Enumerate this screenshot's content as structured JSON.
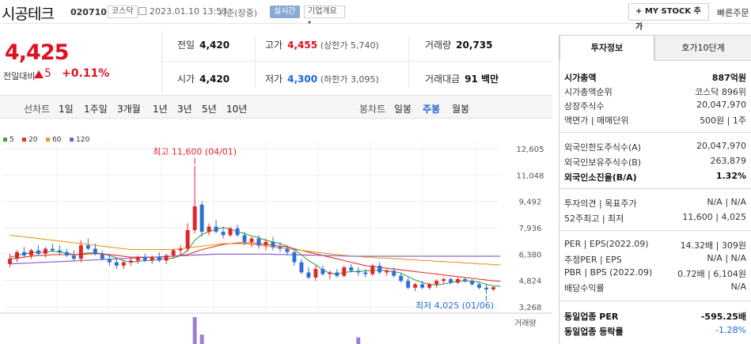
{
  "header": {
    "stock_name": "시공테크",
    "stock_code": "020710",
    "market_badge": "코스닥",
    "datetime": "2023.01.10 13:53",
    "datetime_basis": "기준(장중)",
    "realtime_badge": "실시간",
    "company_overview": "기업개요",
    "mystock_button": "+ MY STOCK 추가",
    "quick_order": "빠른주문"
  },
  "price": {
    "current": "4,425",
    "compare_label": "전일대비",
    "change": "5",
    "change_pct": "+0.11%"
  },
  "quote": {
    "prev_label": "전일",
    "prev": "4,420",
    "high_label": "고가",
    "high": "4,455",
    "upper_limit": "(상한가 5,740)",
    "volume_label": "거래량",
    "volume": "20,735",
    "open_label": "시가",
    "open": "4,420",
    "low_label": "저가",
    "low": "4,300",
    "lower_limit": "(하한가 3,095)",
    "amount_label": "거래대금",
    "amount": "91 백만"
  },
  "periods": {
    "line_label": "선차트",
    "items": [
      "1일",
      "1주일",
      "3개월",
      "1년",
      "3년",
      "5년",
      "10년"
    ],
    "candle_label": "봉차트",
    "candle_items": [
      "일봉",
      "주봉",
      "월봉"
    ],
    "active_candle": "주봉"
  },
  "tabs": [
    "투자정보",
    "호가10단계"
  ],
  "invest": {
    "market_cap_label": "시가총액",
    "market_cap": "887억원",
    "cap_rank_label": "시가총액순위",
    "cap_rank": "코스닥 896위",
    "shares_label": "상장주식수",
    "shares": "20,047,970",
    "par_label": "액면가 | 매매단위",
    "par": "500원 | 1주",
    "foreign_limit_label": "외국인한도주식수(A)",
    "foreign_limit": "20,047,970",
    "foreign_hold_label": "외국인보유주식수(B)",
    "foreign_hold": "263,879",
    "foreign_ratio_label": "외국인소진율(B/A)",
    "foreign_ratio": "1.32%",
    "opinion_label": "투자의견 | 목표주가",
    "opinion": "N/A | N/A",
    "w52_label": "52주최고 | 최저",
    "w52": "11,600 | 4,025",
    "per_label": "PER | EPS(2022.09)",
    "per": "14.32배 | 309원",
    "est_per_label": "추정PER | EPS",
    "est_per": "N/A | N/A",
    "pbr_label": "PBR | BPS (2022.09)",
    "pbr": "0.72배 | 6,104원",
    "div_label": "배당수익률",
    "div": "N/A",
    "ind_per_label": "동일업종 PER",
    "ind_per": "-595.25배",
    "ind_rate_label": "동일업종 등락률",
    "ind_rate": "-1.28%"
  },
  "chart_data": {
    "type": "candlestick",
    "ma_legend": [
      "5",
      "20",
      "60",
      "120"
    ],
    "ma_colors": [
      "#3aa33a",
      "#e53030",
      "#e89a1c",
      "#8a57c8"
    ],
    "y_ticks": [
      "12,605",
      "11,048",
      "9,492",
      "7,936",
      "6,380",
      "4,824",
      "3,268"
    ],
    "y_values": [
      12605,
      11048,
      9492,
      7936,
      6380,
      4824,
      3268
    ],
    "ylim": [
      3268,
      12605
    ],
    "high_annotation": "최고 11,600 (04/01)",
    "low_annotation": "최저 4,025 (01/06)",
    "volume_label": "거래량",
    "candles": [
      {
        "o": 5800,
        "h": 6400,
        "l": 5600,
        "c": 6100
      },
      {
        "o": 6100,
        "h": 6600,
        "l": 5900,
        "c": 6500
      },
      {
        "o": 6500,
        "h": 6800,
        "l": 6200,
        "c": 6300
      },
      {
        "o": 6300,
        "h": 6700,
        "l": 6100,
        "c": 6600
      },
      {
        "o": 6600,
        "h": 6900,
        "l": 6300,
        "c": 6400
      },
      {
        "o": 6400,
        "h": 6800,
        "l": 6200,
        "c": 6700
      },
      {
        "o": 6700,
        "h": 7000,
        "l": 6500,
        "c": 6600
      },
      {
        "o": 6600,
        "h": 6900,
        "l": 6300,
        "c": 6500
      },
      {
        "o": 6500,
        "h": 6700,
        "l": 6200,
        "c": 6300
      },
      {
        "o": 6300,
        "h": 6600,
        "l": 6000,
        "c": 6100
      },
      {
        "o": 6100,
        "h": 7200,
        "l": 5900,
        "c": 6900
      },
      {
        "o": 6900,
        "h": 7300,
        "l": 6600,
        "c": 6700
      },
      {
        "o": 6700,
        "h": 7000,
        "l": 6300,
        "c": 6400
      },
      {
        "o": 6400,
        "h": 6600,
        "l": 6000,
        "c": 6100
      },
      {
        "o": 6100,
        "h": 6400,
        "l": 5700,
        "c": 5900
      },
      {
        "o": 5900,
        "h": 6200,
        "l": 5500,
        "c": 5700
      },
      {
        "o": 5700,
        "h": 6000,
        "l": 5500,
        "c": 5900
      },
      {
        "o": 5900,
        "h": 6200,
        "l": 5700,
        "c": 6000
      },
      {
        "o": 6000,
        "h": 6300,
        "l": 5800,
        "c": 6200
      },
      {
        "o": 6200,
        "h": 6400,
        "l": 5900,
        "c": 6000
      },
      {
        "o": 6000,
        "h": 6300,
        "l": 5800,
        "c": 6200
      },
      {
        "o": 6200,
        "h": 6500,
        "l": 5900,
        "c": 6000
      },
      {
        "o": 6000,
        "h": 6400,
        "l": 5800,
        "c": 6300
      },
      {
        "o": 6300,
        "h": 6700,
        "l": 6100,
        "c": 6600
      },
      {
        "o": 6600,
        "h": 6900,
        "l": 6300,
        "c": 6700
      },
      {
        "o": 6700,
        "h": 8200,
        "l": 6500,
        "c": 7800
      },
      {
        "o": 7800,
        "h": 11600,
        "l": 7600,
        "c": 9200
      },
      {
        "o": 9300,
        "h": 9500,
        "l": 7400,
        "c": 7700
      },
      {
        "o": 7700,
        "h": 8200,
        "l": 7500,
        "c": 8000
      },
      {
        "o": 8000,
        "h": 8400,
        "l": 7600,
        "c": 7700
      },
      {
        "o": 7700,
        "h": 8000,
        "l": 7300,
        "c": 7500
      },
      {
        "o": 7500,
        "h": 8000,
        "l": 7400,
        "c": 7900
      },
      {
        "o": 7900,
        "h": 8100,
        "l": 7400,
        "c": 7500
      },
      {
        "o": 7500,
        "h": 7700,
        "l": 6900,
        "c": 7100
      },
      {
        "o": 7100,
        "h": 7400,
        "l": 6800,
        "c": 7300
      },
      {
        "o": 7300,
        "h": 7500,
        "l": 6700,
        "c": 6900
      },
      {
        "o": 6900,
        "h": 7300,
        "l": 6600,
        "c": 7100
      },
      {
        "o": 7100,
        "h": 7400,
        "l": 6600,
        "c": 6800
      },
      {
        "o": 6800,
        "h": 7100,
        "l": 6500,
        "c": 6700
      },
      {
        "o": 6700,
        "h": 6900,
        "l": 6300,
        "c": 6500
      },
      {
        "o": 6500,
        "h": 6700,
        "l": 5700,
        "c": 5900
      },
      {
        "o": 5900,
        "h": 6100,
        "l": 5200,
        "c": 5300
      },
      {
        "o": 5300,
        "h": 5600,
        "l": 4900,
        "c": 5000
      },
      {
        "o": 5000,
        "h": 5700,
        "l": 4800,
        "c": 5500
      },
      {
        "o": 5500,
        "h": 5700,
        "l": 5100,
        "c": 5200
      },
      {
        "o": 5200,
        "h": 5400,
        "l": 4900,
        "c": 5300
      },
      {
        "o": 5300,
        "h": 5500,
        "l": 5000,
        "c": 5100
      },
      {
        "o": 5100,
        "h": 5700,
        "l": 5000,
        "c": 5600
      },
      {
        "o": 5600,
        "h": 5800,
        "l": 5300,
        "c": 5400
      },
      {
        "o": 5400,
        "h": 5600,
        "l": 5100,
        "c": 5300
      },
      {
        "o": 5300,
        "h": 5500,
        "l": 5000,
        "c": 5200
      },
      {
        "o": 5200,
        "h": 5800,
        "l": 5100,
        "c": 5700
      },
      {
        "o": 5700,
        "h": 5900,
        "l": 5200,
        "c": 5300
      },
      {
        "o": 5300,
        "h": 5500,
        "l": 5100,
        "c": 5400
      },
      {
        "o": 5400,
        "h": 5600,
        "l": 5000,
        "c": 5100
      },
      {
        "o": 5100,
        "h": 5300,
        "l": 4700,
        "c": 4800
      },
      {
        "o": 4800,
        "h": 5000,
        "l": 4300,
        "c": 4400
      },
      {
        "o": 4400,
        "h": 4700,
        "l": 4200,
        "c": 4600
      },
      {
        "o": 4600,
        "h": 4800,
        "l": 4300,
        "c": 4400
      },
      {
        "o": 4400,
        "h": 4700,
        "l": 4300,
        "c": 4600
      },
      {
        "o": 4600,
        "h": 4900,
        "l": 4400,
        "c": 4800
      },
      {
        "o": 4800,
        "h": 5000,
        "l": 4600,
        "c": 4900
      },
      {
        "o": 4900,
        "h": 5000,
        "l": 4600,
        "c": 4700
      },
      {
        "o": 4700,
        "h": 5000,
        "l": 4600,
        "c": 4900
      },
      {
        "o": 4900,
        "h": 5000,
        "l": 4700,
        "c": 4800
      },
      {
        "o": 4800,
        "h": 4900,
        "l": 4500,
        "c": 4600
      },
      {
        "o": 4600,
        "h": 4700,
        "l": 4300,
        "c": 4400
      },
      {
        "o": 4400,
        "h": 4600,
        "l": 4025,
        "c": 4300
      },
      {
        "o": 4300,
        "h": 4500,
        "l": 4200,
        "c": 4425
      }
    ],
    "ma_series": [
      {
        "name": "5",
        "values": [
          6200,
          6300,
          6400,
          6450,
          6500,
          6500,
          6550,
          6500,
          6450,
          6350,
          6400,
          6450,
          6450,
          6400,
          6300,
          6150,
          6000,
          5900,
          5950,
          6000,
          6000,
          6100,
          6100,
          6150,
          6300,
          6600,
          7200,
          7550,
          7700,
          7850,
          7950,
          7850,
          7700,
          7600,
          7450,
          7350,
          7200,
          7100,
          7000,
          6850,
          6650,
          6350,
          6000,
          5750,
          5450,
          5250,
          5200,
          5300,
          5350,
          5350,
          5400,
          5400,
          5450,
          5400,
          5350,
          5250,
          5050,
          4850,
          4700,
          4600,
          4560,
          4620,
          4700,
          4780,
          4800,
          4780,
          4720,
          4600,
          4500,
          4480
        ]
      },
      {
        "name": "20",
        "values": [
          6100,
          6150,
          6200,
          6250,
          6300,
          6300,
          6350,
          6350,
          6350,
          6350,
          6350,
          6400,
          6400,
          6400,
          6350,
          6300,
          6250,
          6200,
          6200,
          6200,
          6200,
          6200,
          6250,
          6250,
          6300,
          6350,
          6500,
          6650,
          6750,
          6850,
          6950,
          7000,
          7050,
          7050,
          7050,
          7000,
          6950,
          6900,
          6850,
          6800,
          6700,
          6600,
          6500,
          6400,
          6300,
          6200,
          6100,
          6000,
          5900,
          5800,
          5700,
          5650,
          5600,
          5550,
          5500,
          5450,
          5400,
          5350,
          5300,
          5250,
          5200,
          5150,
          5100,
          5050,
          5000,
          4950,
          4900,
          4850,
          4800,
          4780
        ]
      },
      {
        "name": "60",
        "values": [
          7500,
          7450,
          7400,
          7350,
          7300,
          7250,
          7200,
          7150,
          7100,
          7050,
          7000,
          6950,
          6900,
          6850,
          6800,
          6750,
          6700,
          6650,
          6650,
          6650,
          6650,
          6650,
          6650,
          6650,
          6700,
          6750,
          6800,
          6850,
          6900,
          6950,
          7000,
          7000,
          7000,
          7000,
          6950,
          6900,
          6850,
          6800,
          6750,
          6700,
          6650,
          6600,
          6550,
          6500,
          6450,
          6400,
          6350,
          6300,
          6250,
          6250,
          6200,
          6200,
          6150,
          6150,
          6100,
          6100,
          6050,
          6050,
          6000,
          6000,
          5950,
          5950,
          5900,
          5900,
          5850,
          5850,
          5800,
          5800,
          5750,
          5750
        ]
      },
      {
        "name": "120",
        "values": [
          5800,
          5820,
          5840,
          5860,
          5880,
          5900,
          5920,
          5940,
          5960,
          5980,
          6000,
          6020,
          6040,
          6060,
          6080,
          6100,
          6120,
          6140,
          6160,
          6180,
          6200,
          6220,
          6240,
          6260,
          6280,
          6300,
          6320,
          6340,
          6360,
          6380,
          6380,
          6380,
          6380,
          6380,
          6380,
          6380,
          6380,
          6370,
          6360,
          6350,
          6340,
          6330,
          6320,
          6310,
          6300,
          6290,
          6280,
          6270,
          6260,
          6250,
          6250,
          6250,
          6250,
          6250,
          6250,
          6250,
          6250,
          6250,
          6250,
          6250,
          6250,
          6250,
          6250,
          6250,
          6250,
          6250,
          6250,
          6250,
          6250,
          6250
        ]
      }
    ],
    "volume_bars": [
      {
        "i": 26,
        "v": 1.0
      },
      {
        "i": 27,
        "v": 0.35
      },
      {
        "i": 49,
        "v": 0.25
      }
    ]
  }
}
